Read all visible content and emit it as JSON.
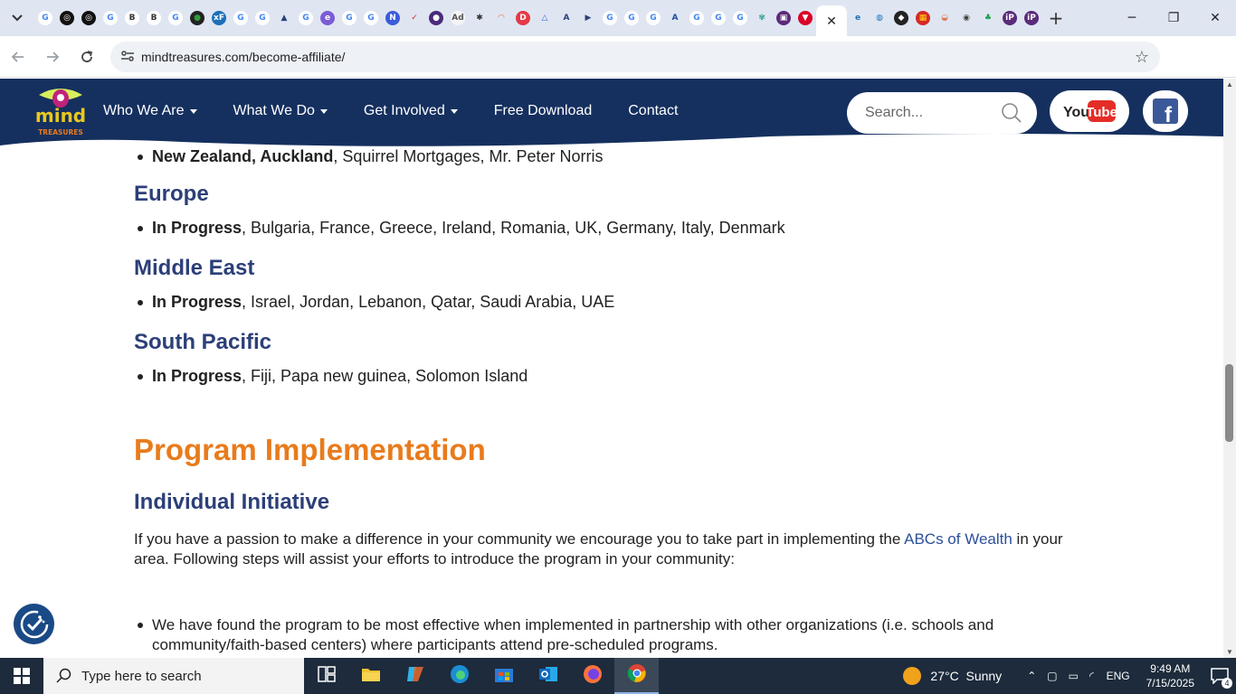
{
  "browser": {
    "tab_favicons": [
      {
        "icon": "google-icon",
        "glyph": "G",
        "color": "#4285f4",
        "bg": "#ffffff"
      },
      {
        "icon": "openai-icon",
        "glyph": "◎",
        "color": "#ffffff",
        "bg": "#111111"
      },
      {
        "icon": "openai-icon",
        "glyph": "◎",
        "color": "#ffffff",
        "bg": "#111111"
      },
      {
        "icon": "google-icon",
        "glyph": "G",
        "color": "#4285f4",
        "bg": "#ffffff"
      },
      {
        "icon": "b-icon",
        "glyph": "B",
        "color": "#333333",
        "bg": "#ffffff"
      },
      {
        "icon": "b-icon",
        "glyph": "B",
        "color": "#333333",
        "bg": "#ffffff"
      },
      {
        "icon": "google-icon",
        "glyph": "G",
        "color": "#4285f4",
        "bg": "#ffffff"
      },
      {
        "icon": "globe-icon",
        "glyph": "●",
        "color": "#2e9d3b",
        "bg": "#222222"
      },
      {
        "icon": "xf-icon",
        "glyph": "xF",
        "color": "#ffffff",
        "bg": "#1d6fb8"
      },
      {
        "icon": "google-icon",
        "glyph": "G",
        "color": "#4285f4",
        "bg": "#ffffff"
      },
      {
        "icon": "google-icon",
        "glyph": "G",
        "color": "#4285f4",
        "bg": "#ffffff"
      },
      {
        "icon": "hat-icon",
        "glyph": "▲",
        "color": "#2c3f78",
        "bg": "#dfe6f2"
      },
      {
        "icon": "google-icon",
        "glyph": "G",
        "color": "#4285f4",
        "bg": "#ffffff"
      },
      {
        "icon": "e-icon",
        "glyph": "e",
        "color": "#ffffff",
        "bg": "#7b5cd6"
      },
      {
        "icon": "google-icon",
        "glyph": "G",
        "color": "#4285f4",
        "bg": "#ffffff"
      },
      {
        "icon": "google-icon",
        "glyph": "G",
        "color": "#4285f4",
        "bg": "#ffffff"
      },
      {
        "icon": "n-icon",
        "glyph": "N",
        "color": "#ffffff",
        "bg": "#3b5bdb"
      },
      {
        "icon": "check-icon",
        "glyph": "✓",
        "color": "#d62828",
        "bg": "#dfe6f2"
      },
      {
        "icon": "dot-icon",
        "glyph": "●",
        "color": "#ffffff",
        "bg": "#4a2a7a"
      },
      {
        "icon": "adk-icon",
        "glyph": "Ad",
        "color": "#555555",
        "bg": "#f4f4f4"
      },
      {
        "icon": "gear-icon",
        "glyph": "✱",
        "color": "#333333",
        "bg": "#dfe6f2"
      },
      {
        "icon": "cloud-icon",
        "glyph": "◠",
        "color": "#f26b21",
        "bg": "#dfe6f2"
      },
      {
        "icon": "d-icon",
        "glyph": "D",
        "color": "#ffffff",
        "bg": "#e63946"
      },
      {
        "icon": "triangle-icon",
        "glyph": "△",
        "color": "#3a6ad6",
        "bg": "#dfe6f2"
      },
      {
        "icon": "a-icon",
        "glyph": "A",
        "color": "#2c3f78",
        "bg": "#dfe6f2"
      },
      {
        "icon": "play-icon",
        "glyph": "▶",
        "color": "#2c3f78",
        "bg": "#dfe6f2"
      },
      {
        "icon": "google-icon",
        "glyph": "G",
        "color": "#4285f4",
        "bg": "#ffffff"
      },
      {
        "icon": "google-icon",
        "glyph": "G",
        "color": "#4285f4",
        "bg": "#ffffff"
      },
      {
        "icon": "google-icon",
        "glyph": "G",
        "color": "#4285f4",
        "bg": "#ffffff"
      },
      {
        "icon": "ai-icon",
        "glyph": "A",
        "color": "#1f4fa0",
        "bg": "#dfe6f2"
      },
      {
        "icon": "google-icon",
        "glyph": "G",
        "color": "#4285f4",
        "bg": "#ffffff"
      },
      {
        "icon": "google-icon",
        "glyph": "G",
        "color": "#4285f4",
        "bg": "#ffffff"
      },
      {
        "icon": "google-icon",
        "glyph": "G",
        "color": "#4285f4",
        "bg": "#ffffff"
      },
      {
        "icon": "butterfly-icon",
        "glyph": "✾",
        "color": "#2a9d8f",
        "bg": "#dfe6f2"
      },
      {
        "icon": "p-icon",
        "glyph": "▣",
        "color": "#ffffff",
        "bg": "#5b2a7a"
      },
      {
        "icon": "shield-icon",
        "glyph": "▼",
        "color": "#ffffff",
        "bg": "#d90429"
      }
    ],
    "active_tab_close": "✕",
    "tab_favicons_after": [
      {
        "icon": "ie-icon",
        "glyph": "e",
        "color": "#1d6fb8",
        "bg": "#dfe6f2"
      },
      {
        "icon": "globe-icon",
        "glyph": "◍",
        "color": "#1d6fb8",
        "bg": "#dfe6f2"
      },
      {
        "icon": "shield-icon",
        "glyph": "◆",
        "color": "#ffffff",
        "bg": "#222222"
      },
      {
        "icon": "grid-icon",
        "glyph": "▦",
        "color": "#ffd60a",
        "bg": "#d62828"
      },
      {
        "icon": "cloud-icon",
        "glyph": "◒",
        "color": "#e07a5f",
        "bg": "#dfe6f2"
      },
      {
        "icon": "globe-icon",
        "glyph": "◉",
        "color": "#444444",
        "bg": "#dfe6f2"
      },
      {
        "icon": "tree-icon",
        "glyph": "♣",
        "color": "#1b9e4b",
        "bg": "#dfe6f2"
      },
      {
        "icon": "ip-icon",
        "glyph": "iP",
        "color": "#ffffff",
        "bg": "#5b2a7a"
      },
      {
        "icon": "ip-icon",
        "glyph": "iP",
        "color": "#ffffff",
        "bg": "#5b2a7a"
      }
    ],
    "new_tab": "+",
    "window_controls": {
      "minimize": "─",
      "restore": "❐",
      "close": "✕"
    },
    "url": "mindtreasures.com/become-affiliate/"
  },
  "site": {
    "brand_color": "#15305f",
    "accent_color": "#e87b1c",
    "logo_text_1": "mind",
    "logo_text_2": "TREASURES",
    "nav": [
      {
        "label": "Who We Are",
        "dropdown": true
      },
      {
        "label": "What We Do",
        "dropdown": true
      },
      {
        "label": "Get Involved",
        "dropdown": true
      },
      {
        "label": "Free Download",
        "dropdown": false
      },
      {
        "label": "Contact",
        "dropdown": false
      }
    ],
    "search_placeholder": "Search...",
    "youtube_label_1": "You",
    "youtube_label_2": "Tube",
    "facebook_label": "f"
  },
  "content": {
    "nz": {
      "bold": "New Zealand, Auckland",
      "rest": ", Squirrel Mortgages, Mr. Peter Norris"
    },
    "regions": [
      {
        "heading": "Europe",
        "bold": "In Progress",
        "rest": ", Bulgaria, France, Greece, Ireland, Romania, UK, Germany, Italy, Denmark"
      },
      {
        "heading": "Middle East",
        "bold": "In Progress",
        "rest": ", Israel, Jordan, Lebanon, Qatar, Saudi Arabia, UAE"
      },
      {
        "heading": "South Pacific",
        "bold": "In Progress",
        "rest": ", Fiji, Papa new guinea, Solomon Island"
      }
    ],
    "section_title": "Program Implementation",
    "sub_title": "Individual Initiative",
    "intro_before": "If you have a passion to make a difference in your community we encourage you to take part in implementing the ",
    "intro_link": "ABCs of Wealth",
    "intro_after": " in your area. Following steps will assist your efforts to introduce the program in your community:",
    "steps": [
      "We have found the program to be most effective when implemented in partnership with other organizations (i.e. schools and community/faith-based centers) where participants attend pre-scheduled programs."
    ]
  },
  "taskbar": {
    "search_placeholder": "Type here to search",
    "apps": [
      {
        "icon": "task-view-icon"
      },
      {
        "icon": "file-explorer-icon"
      },
      {
        "icon": "copilot-icon"
      },
      {
        "icon": "edge-icon"
      },
      {
        "icon": "store-icon"
      },
      {
        "icon": "outlook-icon"
      },
      {
        "icon": "firefox-icon"
      },
      {
        "icon": "chrome-icon",
        "active": true
      }
    ],
    "weather_temp": "27°C",
    "weather_text": "Sunny",
    "lang": "ENG",
    "time": "9:49 AM",
    "date": "7/15/2025",
    "notification_count": "4"
  }
}
